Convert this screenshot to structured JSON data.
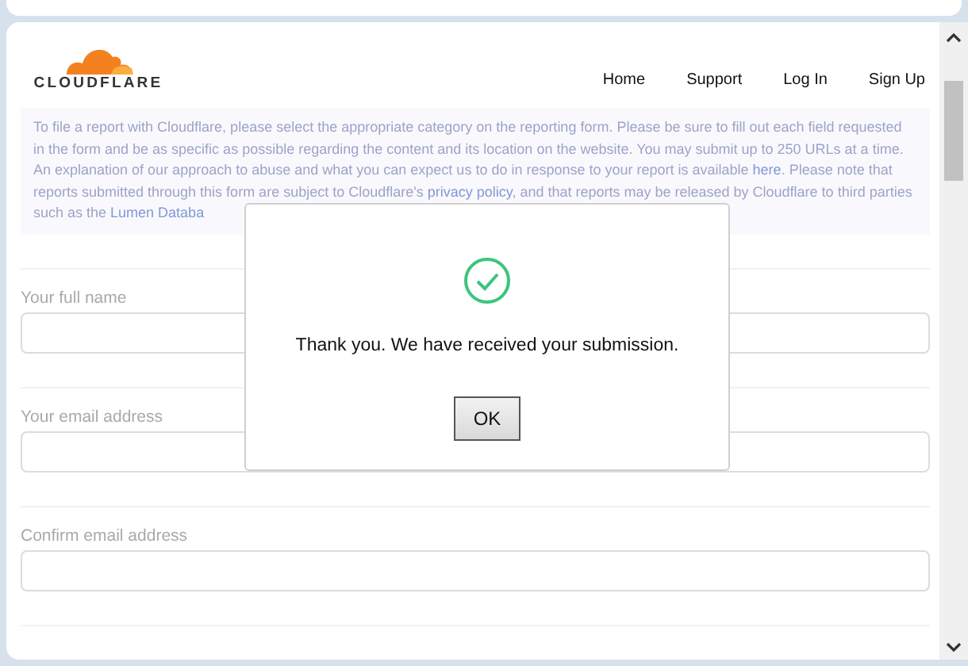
{
  "header": {
    "logo_text": "CLOUDFLARE",
    "nav": [
      "Home",
      "Support",
      "Log In",
      "Sign Up"
    ]
  },
  "intro": [
    {
      "kind": "text",
      "text": "To file a report with Cloudflare, please select the appropriate category on the reporting form. Please be sure to fill out each field requested in the form and be as specific as possible regarding the content and its location on the website. You may submit up to 250 URLs at a time. An explanation of our approach to abuse and what you can expect us to do in response to your report is available "
    },
    {
      "kind": "link",
      "text": "here"
    },
    {
      "kind": "text",
      "text": ". Please note that reports submitted through this form are subject to Cloudflare's "
    },
    {
      "kind": "link",
      "text": "privacy policy"
    },
    {
      "kind": "text",
      "text": ", and that reports may be released by Cloudflare to third parties such as the "
    },
    {
      "kind": "link",
      "text": "Lumen Databa"
    }
  ],
  "fields": [
    {
      "label": "Your full name"
    },
    {
      "label": "Your email address"
    },
    {
      "label": "Confirm email address"
    }
  ],
  "dialog": {
    "message": "Thank you. We have received your submission.",
    "button": "OK"
  }
}
